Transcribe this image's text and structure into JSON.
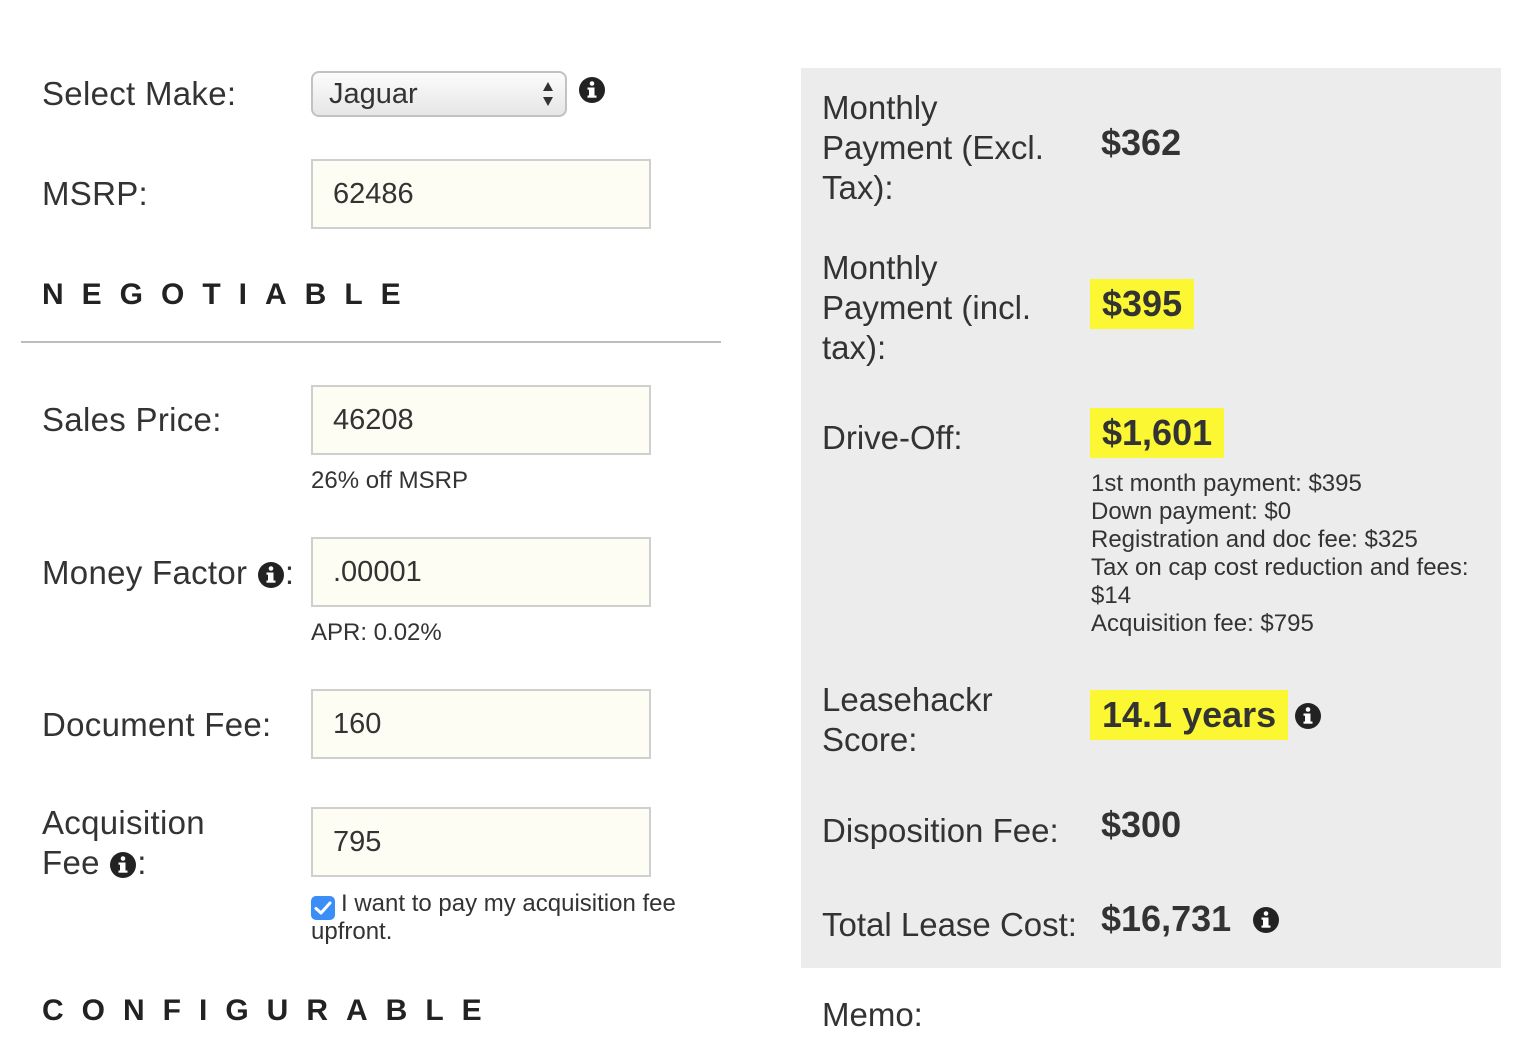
{
  "form": {
    "make_label": "Select Make:",
    "make_value": "Jaguar",
    "msrp_label": "MSRP:",
    "msrp_value": "62486",
    "negotiable_heading": "NEGOTIABLE",
    "sales_price_label": "Sales Price:",
    "sales_price_value": "46208",
    "sales_price_hint": "26% off MSRP",
    "money_factor_label": "Money Factor",
    "money_factor_colon": ":",
    "money_factor_value": ".00001",
    "money_factor_hint": "APR: 0.02%",
    "doc_fee_label": "Document Fee:",
    "doc_fee_value": "160",
    "acq_fee_label_line1": "Acquisition",
    "acq_fee_label_line2": "Fee",
    "acq_fee_colon": ":",
    "acq_fee_value": "795",
    "acq_upfront_checked": true,
    "acq_upfront_label": "I want to pay my acquisition fee upfront.",
    "configurable_heading": "CONFIGURABLE"
  },
  "results": {
    "monthly_excl_label_1": "Monthly",
    "monthly_excl_label_2": "Payment (Excl.",
    "monthly_excl_label_3": "Tax):",
    "monthly_excl_value": "$362",
    "monthly_incl_label_1": "Monthly",
    "monthly_incl_label_2": "Payment (incl.",
    "monthly_incl_label_3": "tax):",
    "monthly_incl_value": "$395",
    "drive_off_label": "Drive-Off:",
    "drive_off_value": "$1,601",
    "breakdown": [
      "1st month payment: $395",
      "Down payment: $0",
      "Registration and doc fee: $325",
      "Tax on cap cost reduction and fees: $14",
      "Acquisition fee: $795"
    ],
    "score_label_1": "Leasehackr",
    "score_label_2": "Score:",
    "score_value": "14.1 years",
    "disposition_label": "Disposition Fee:",
    "disposition_value": "$300",
    "total_label": "Total Lease Cost:",
    "total_value": "$16,731",
    "memo_label": "Memo:"
  },
  "colors": {
    "highlight": "#fcf733",
    "panel_bg": "#ececec",
    "field_bg": "#fefdf3",
    "checkbox": "#3a8ef5"
  },
  "icons": [
    "info-icon",
    "select-arrows-icon",
    "checkmark-icon"
  ]
}
